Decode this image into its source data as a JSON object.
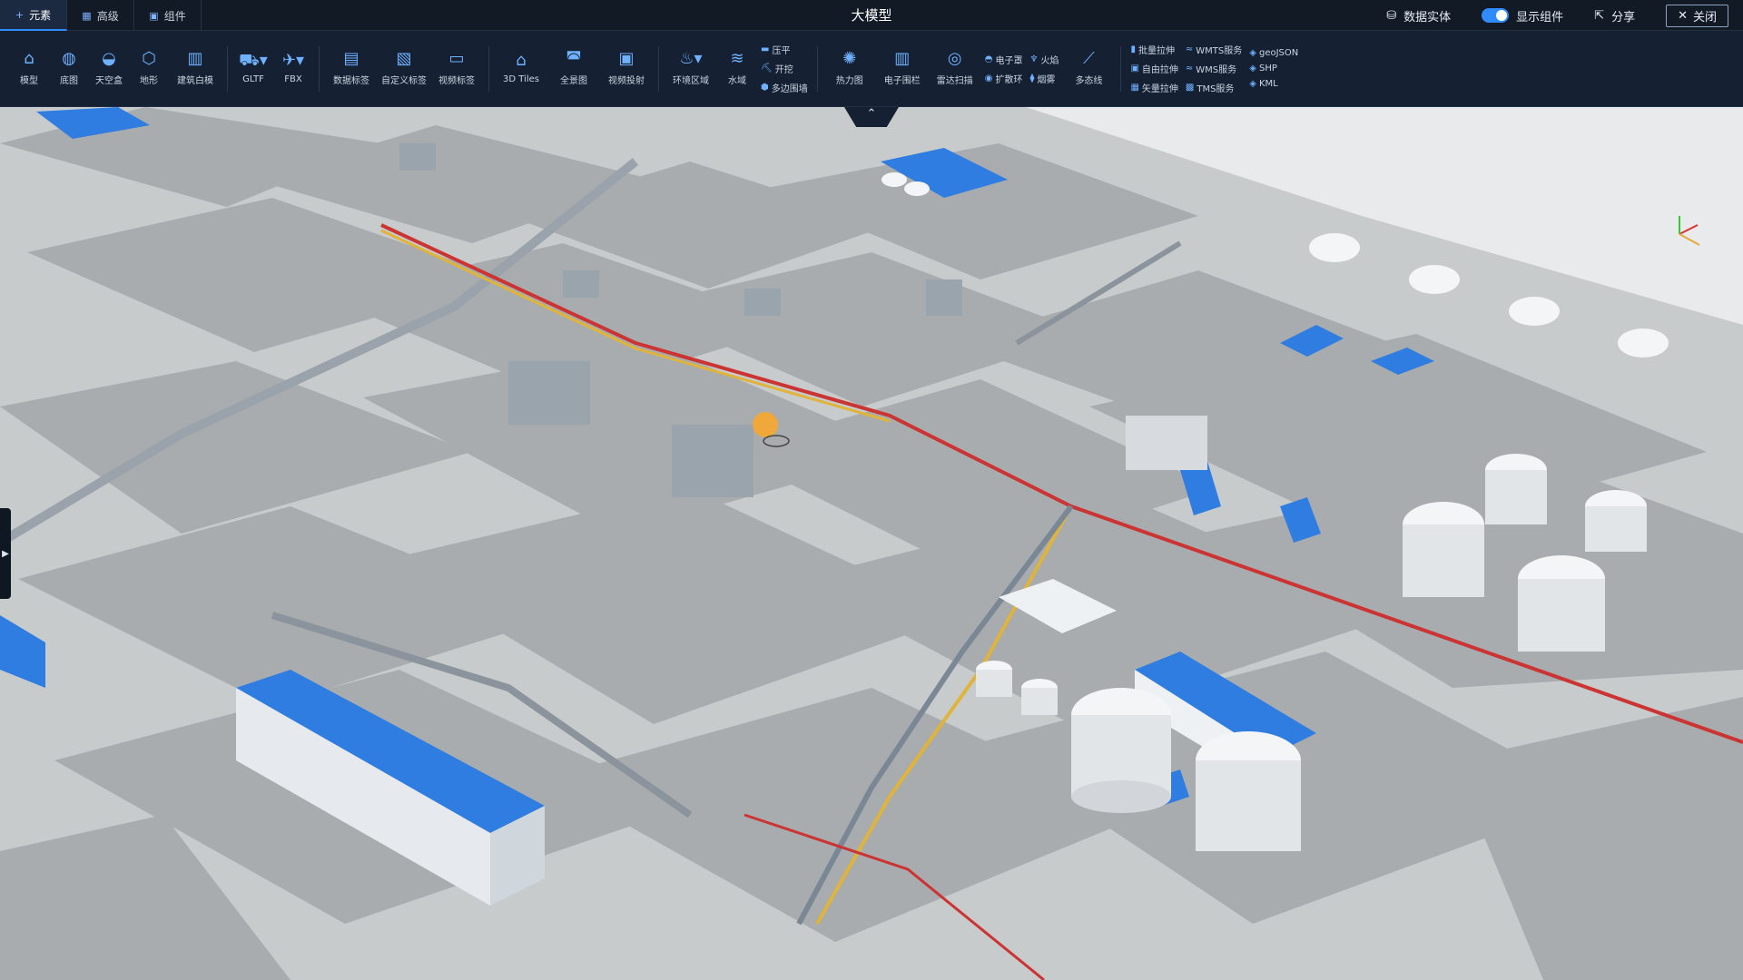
{
  "tabs": [
    {
      "label": "元素",
      "icon": "plus-icon",
      "active": true
    },
    {
      "label": "高级",
      "icon": "grid-icon",
      "active": false
    },
    {
      "label": "组件",
      "icon": "component-icon",
      "active": false
    }
  ],
  "title": "大模型",
  "right": {
    "data_entity": "数据实体",
    "show_components": "显示组件",
    "share": "分享",
    "close": "关闭"
  },
  "tools_main": [
    {
      "label": "模型",
      "icon": "model-icon"
    },
    {
      "label": "底图",
      "icon": "basemap-icon"
    },
    {
      "label": "天空盒",
      "icon": "skybox-icon"
    },
    {
      "label": "地形",
      "icon": "terrain-icon"
    },
    {
      "label": "建筑白模",
      "icon": "building-icon"
    }
  ],
  "tools_format": [
    {
      "label": "GLTF",
      "icon": "gltf-icon"
    },
    {
      "label": "FBX",
      "icon": "fbx-icon"
    }
  ],
  "tools_label": [
    {
      "label": "数据标签",
      "icon": "data-label-icon"
    },
    {
      "label": "自定义标签",
      "icon": "custom-label-icon"
    },
    {
      "label": "视频标签",
      "icon": "video-label-icon"
    }
  ],
  "tools_tiles": [
    {
      "label": "3D Tiles",
      "icon": "tiles-icon"
    },
    {
      "label": "全景图",
      "icon": "panorama-icon"
    },
    {
      "label": "视频投射",
      "icon": "video-project-icon"
    }
  ],
  "tools_env": [
    {
      "label": "环境区域",
      "icon": "env-area-icon"
    },
    {
      "label": "水域",
      "icon": "water-icon"
    }
  ],
  "stack_env": [
    "压平",
    "开挖",
    "多边围墙"
  ],
  "tools_vis": [
    {
      "label": "热力图",
      "icon": "heatmap-icon"
    },
    {
      "label": "电子围栏",
      "icon": "fence-icon"
    },
    {
      "label": "雷达扫描",
      "icon": "radar-icon"
    }
  ],
  "stack_fx1": [
    "电子罩",
    "扩散环"
  ],
  "stack_fx2": [
    "火焰",
    "烟雾"
  ],
  "tools_more": [
    {
      "label": "多态线",
      "icon": "polyline-icon"
    }
  ],
  "stack_extrude": [
    "批量拉伸",
    "自由拉伸",
    "矢量拉伸"
  ],
  "stack_service": [
    "WMTS服务",
    "WMS服务",
    "TMS服务"
  ],
  "stack_file": [
    "geoJSON",
    "SHP",
    "KML"
  ]
}
